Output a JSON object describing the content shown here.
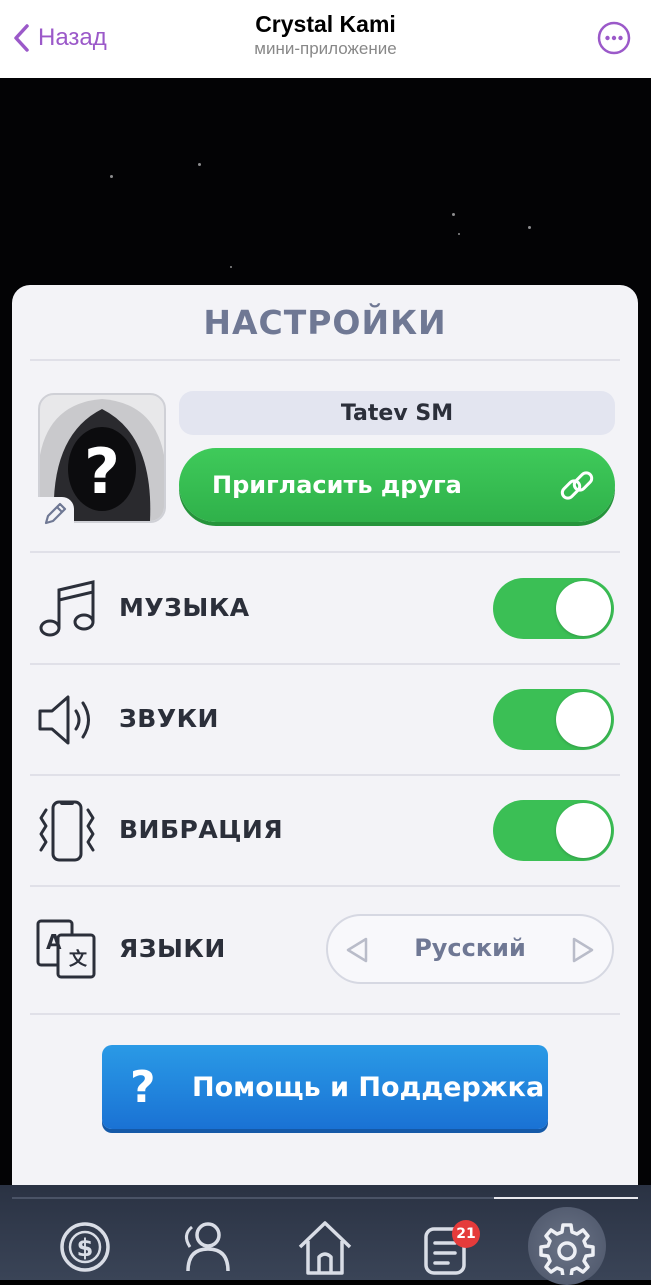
{
  "header": {
    "back_label": "Назад",
    "title": "Crystal Kami",
    "subtitle": "мини-приложение"
  },
  "settings": {
    "title": "НАСТРОЙКИ",
    "username": "Tatev SM",
    "invite_label": "Пригласить друга",
    "rows": [
      {
        "label": "МУЗЫКА",
        "icon": "music-note-icon",
        "enabled": true
      },
      {
        "label": "ЗВУКИ",
        "icon": "speaker-icon",
        "enabled": true
      },
      {
        "label": "ВИБРАЦИЯ",
        "icon": "vibration-icon",
        "enabled": true
      }
    ],
    "language": {
      "label": "ЯЗЫКИ",
      "icon": "translate-icon",
      "value": "Русский"
    },
    "help_label": "Помощь и Поддержка",
    "help_icon": "?"
  },
  "nav": {
    "items": [
      "dollar-coin-icon",
      "friends-icon",
      "home-icon",
      "tasks-icon",
      "settings-gear-icon"
    ],
    "tasks_badge": "21",
    "active": "settings-gear-icon"
  },
  "colors": {
    "accent_purple": "#9b59c9",
    "toggle_on": "#3bbf55",
    "invite_green": "#3fca5a",
    "help_blue": "#2a9ae6",
    "badge_red": "#e53b3b"
  }
}
